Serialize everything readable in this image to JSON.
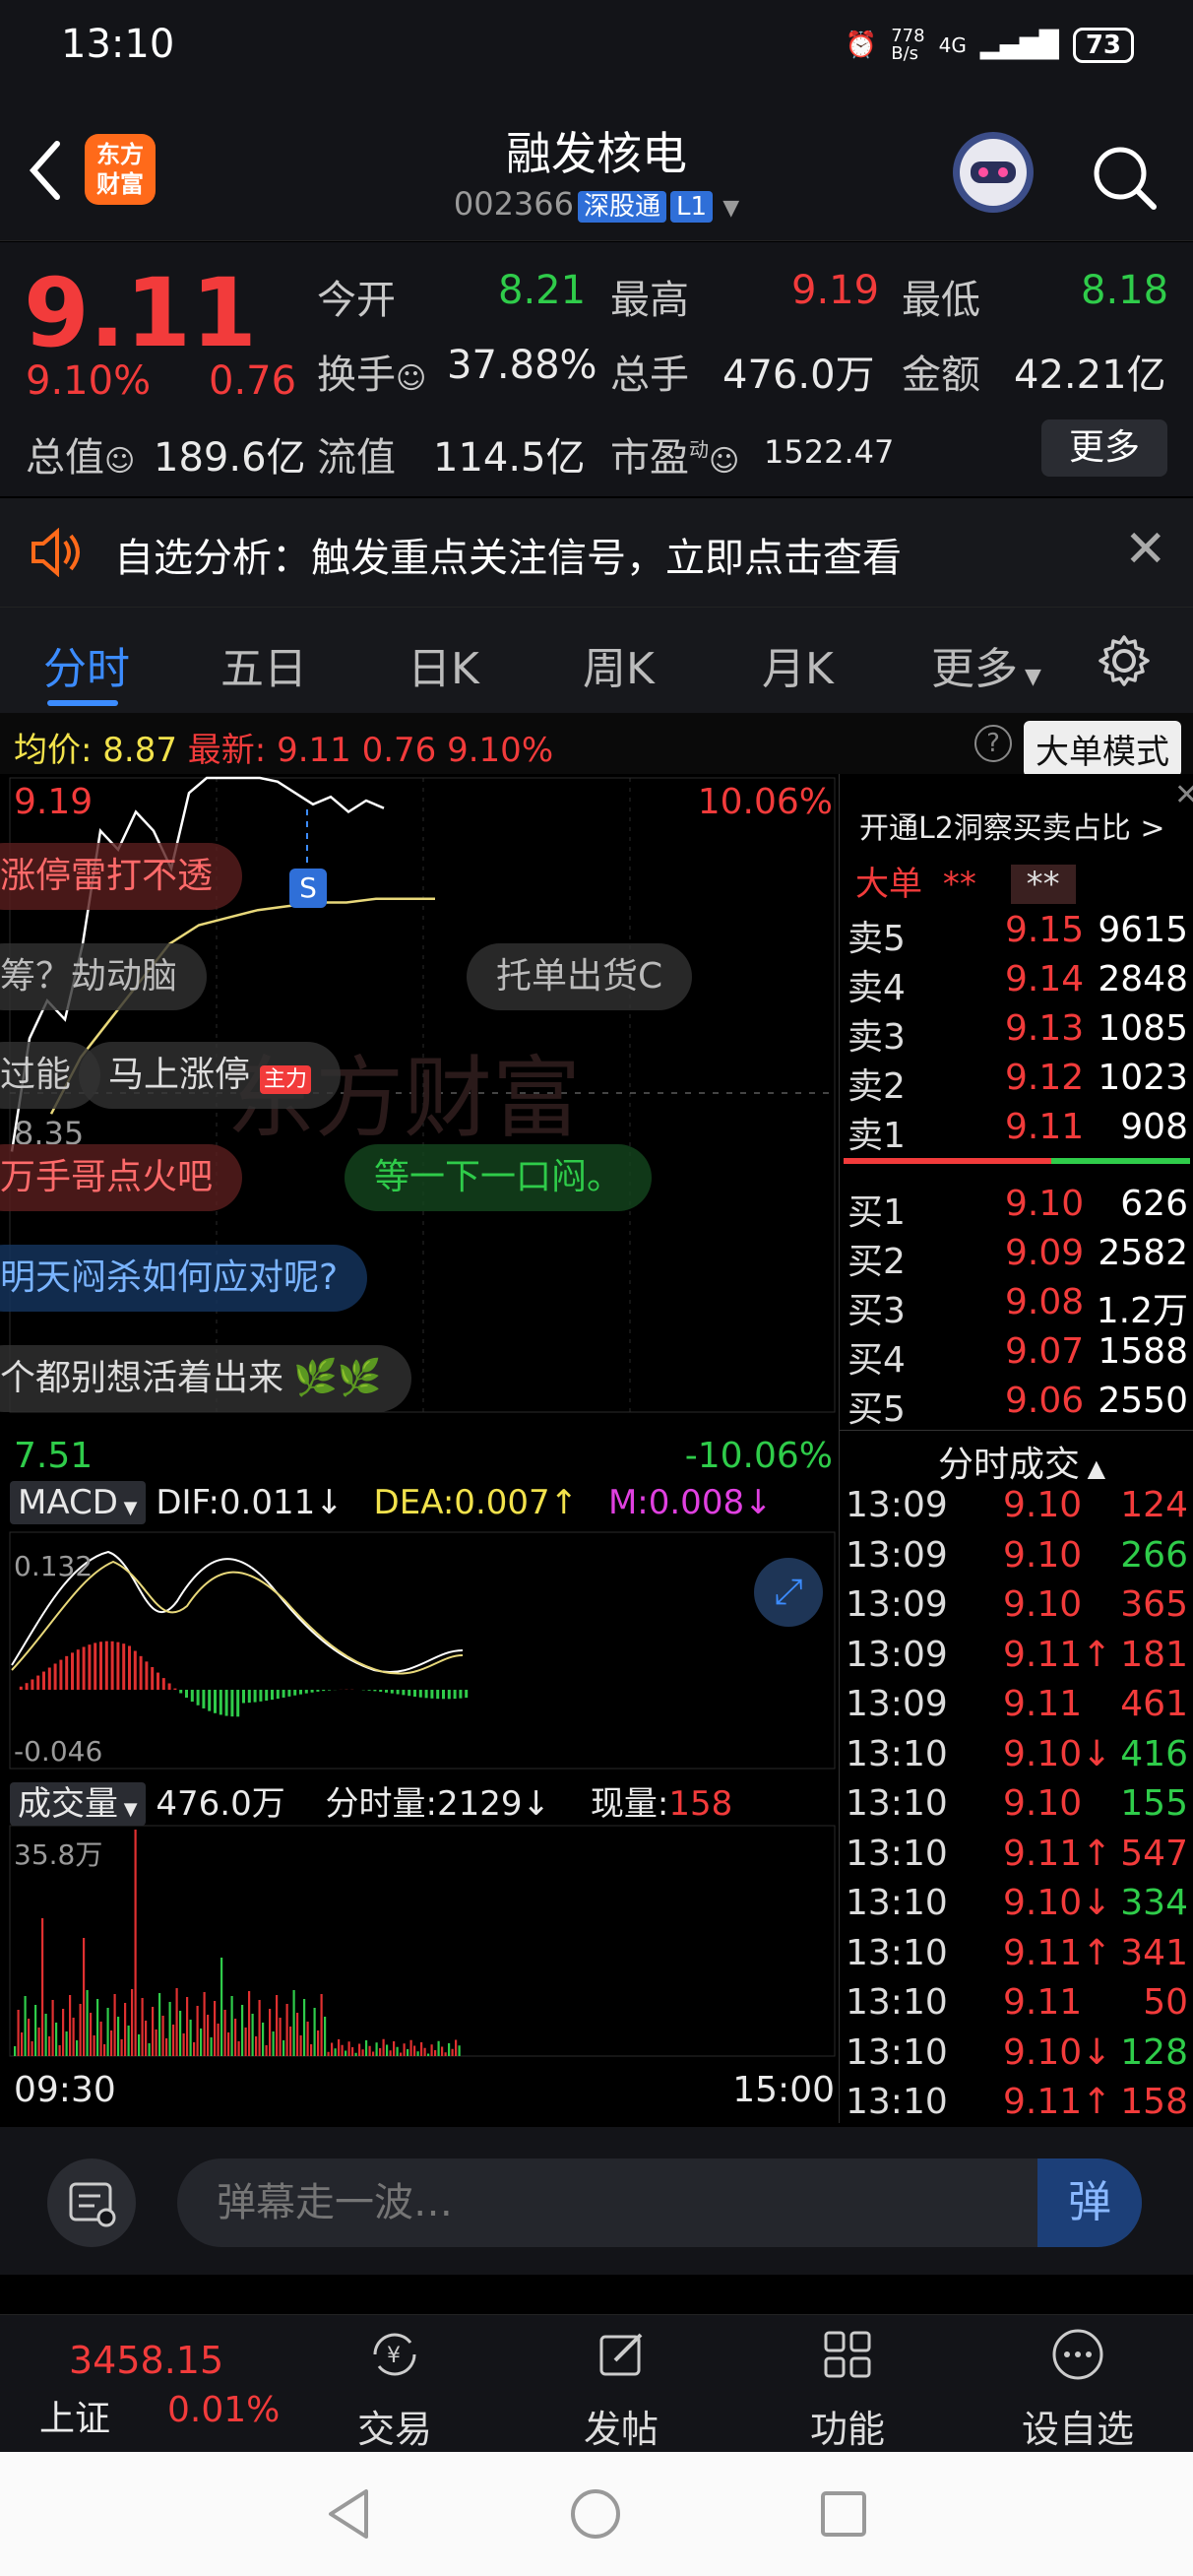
{
  "status": {
    "time": "13:10",
    "net_speed": "778\nB/s",
    "signal": "4G",
    "battery": "73"
  },
  "header": {
    "back_label": "<",
    "logo_text": "东方\n财富",
    "stock_name": "融发核电",
    "stock_code": "002366",
    "tag": "深股通",
    "level": "L1"
  },
  "quote": {
    "price": "9.11",
    "pct": "9.10%",
    "change": "0.76",
    "open_label": "今开",
    "open": "8.21",
    "high_label": "最高",
    "high": "9.19",
    "low_label": "最低",
    "low": "8.18",
    "turnover_label": "换手",
    "turnover": "37.88%",
    "volume_label": "总手",
    "volume": "476.0万",
    "amount_label": "金额",
    "amount": "42.21亿",
    "mktcap_label": "总值",
    "mktcap": "189.6亿",
    "float_label": "流值",
    "float": "114.5亿",
    "pe_label": "市盈",
    "pe_sup": "动",
    "pe": "1522.47",
    "more": "更多"
  },
  "notice": {
    "text": "自选分析：触发重点关注信号，立即点击查看"
  },
  "tabs": [
    "分时",
    "五日",
    "日K",
    "周K",
    "月K",
    "更多"
  ],
  "chart_head": {
    "avg_label": "均价:",
    "avg": "8.87",
    "latest_label": "最新:",
    "latest": "9.11",
    "chg": "0.76",
    "pct": "9.10%",
    "bigorder": "大单模式"
  },
  "chart": {
    "max_price": "9.19",
    "max_pct": "10.06%",
    "min_price": "7.51",
    "min_pct": "-10.06%",
    "ref_price": "8.35",
    "macd_label": "MACD",
    "dif": "DIF:0.011↓",
    "dea": "DEA:0.007↑",
    "m": "M:0.008↓",
    "macd_top": "0.132",
    "macd_bottom": "-0.046",
    "vol_label": "成交量",
    "vol_total": "476.0万",
    "vol_tick": "分时量:2129↓",
    "vol_now_label": "现量:",
    "vol_now": "158",
    "vol_max": "35.8万",
    "time_start": "09:30",
    "time_end": "15:00",
    "s_marker": "S",
    "price_series": [
      8.2,
      8.5,
      8.6,
      8.55,
      8.75,
      9.05,
      9.0,
      9.1,
      9.05,
      8.95,
      9.15,
      9.19,
      9.19,
      9.19,
      9.19,
      9.18,
      9.15,
      9.12,
      9.14,
      9.1,
      9.13,
      9.11
    ],
    "avg_series": [
      8.3,
      8.45,
      8.55,
      8.65,
      8.75,
      8.8,
      8.82,
      8.84,
      8.85,
      8.86,
      8.86,
      8.87,
      8.87,
      8.87
    ]
  },
  "bullets": [
    {
      "text": "涨停雷打不透"
    },
    {
      "text": "筹？劫动脑"
    },
    {
      "text": "托单出货C"
    },
    {
      "text": "过能"
    },
    {
      "text": "马上涨停"
    },
    {
      "text": "万手哥点火吧"
    },
    {
      "text": "等一下一口闷。"
    },
    {
      "text": "明天闷杀如何应对呢?"
    },
    {
      "text": "个都别想活着出来"
    }
  ],
  "watermark": "东方财富",
  "orderbook": {
    "promo": "开通L2洞察买卖占比 >",
    "big_label": "大单",
    "big_mask": "**",
    "big_mask2": "**",
    "asks": [
      {
        "label": "卖5",
        "price": "9.15",
        "vol": "9615"
      },
      {
        "label": "卖4",
        "price": "9.14",
        "vol": "2848"
      },
      {
        "label": "卖3",
        "price": "9.13",
        "vol": "1085"
      },
      {
        "label": "卖2",
        "price": "9.12",
        "vol": "1023"
      },
      {
        "label": "卖1",
        "price": "9.11",
        "vol": "908"
      }
    ],
    "bids": [
      {
        "label": "买1",
        "price": "9.10",
        "vol": "626"
      },
      {
        "label": "买2",
        "price": "9.09",
        "vol": "2582"
      },
      {
        "label": "买3",
        "price": "9.08",
        "vol": "1.2万"
      },
      {
        "label": "买4",
        "price": "9.07",
        "vol": "1588"
      },
      {
        "label": "买5",
        "price": "9.06",
        "vol": "2550"
      }
    ]
  },
  "trades": {
    "title": "分时成交",
    "rows": [
      {
        "t": "13:09",
        "p": "9.10",
        "v": "124",
        "c": "red"
      },
      {
        "t": "13:09",
        "p": "9.10",
        "v": "266",
        "c": "green"
      },
      {
        "t": "13:09",
        "p": "9.10",
        "v": "365",
        "c": "red"
      },
      {
        "t": "13:09",
        "p": "9.11↑",
        "v": "181",
        "c": "red"
      },
      {
        "t": "13:09",
        "p": "9.11",
        "v": "461",
        "c": "red"
      },
      {
        "t": "13:10",
        "p": "9.10↓",
        "v": "416",
        "c": "green"
      },
      {
        "t": "13:10",
        "p": "9.10",
        "v": "155",
        "c": "green"
      },
      {
        "t": "13:10",
        "p": "9.11↑",
        "v": "547",
        "c": "red"
      },
      {
        "t": "13:10",
        "p": "9.10↓",
        "v": "334",
        "c": "green"
      },
      {
        "t": "13:10",
        "p": "9.11↑",
        "v": "341",
        "c": "red"
      },
      {
        "t": "13:10",
        "p": "9.11",
        "v": "50",
        "c": "red"
      },
      {
        "t": "13:10",
        "p": "9.10↓",
        "v": "128",
        "c": "green"
      },
      {
        "t": "13:10",
        "p": "9.11↑",
        "v": "158",
        "c": "red"
      }
    ]
  },
  "comment": {
    "placeholder": "弹幕走一波…",
    "send": "弹"
  },
  "bottom_nav": {
    "index_value": "3458.15",
    "index_name": "上证",
    "index_pct": "0.01%",
    "items": [
      "交易",
      "发帖",
      "功能",
      "设自选"
    ]
  },
  "colors": {
    "up": "#f23b3b",
    "down": "#2fcc4a",
    "accent": "#3c8cff",
    "brand": "#ff6a1a"
  }
}
